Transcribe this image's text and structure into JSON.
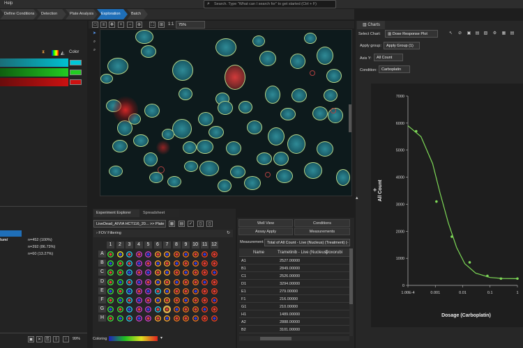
{
  "menu": {
    "help": "Help"
  },
  "search": {
    "placeholder": "Search. Type \"What can I search for\" to get started (Ctrl + F)"
  },
  "workflow": [
    "Define Conditions",
    "Detection",
    "Plate Analysis",
    "Exploration",
    "Batch"
  ],
  "left_panel": {
    "color_label": "Color",
    "stats": [
      {
        "label": "lum/",
        "n": "n=452",
        "pct": "(100%)"
      },
      {
        "label": "",
        "n": "n=392",
        "pct": "(86.73%)"
      },
      {
        "label": "",
        "n": "n=60",
        "pct": "(13.27%)"
      }
    ],
    "zoom_pct": "99%",
    "legend_colors": [
      "#00c8d8",
      "#22cc22",
      "#cc1111"
    ]
  },
  "image_toolbar": {
    "zoom_ratio": "1:1",
    "zoom_select": "75%"
  },
  "explorer": {
    "tabs": [
      "Experiment Explorer",
      "Spreadsheet"
    ],
    "dataset": "LiveDead_AIVIA HCT116_20...",
    "plate_link": ">> Plate",
    "fov_filter": "FOV Filtering",
    "coloring_label": "Coloring",
    "cols": [
      "1",
      "2",
      "3",
      "4",
      "5",
      "6",
      "7",
      "8",
      "9",
      "10",
      "11",
      "12"
    ],
    "rows": [
      "A",
      "B",
      "C",
      "D",
      "E",
      "F",
      "G",
      "H"
    ]
  },
  "table": {
    "buttons": [
      "Well View",
      "Conditions",
      "Assay Apply",
      "Measurements"
    ],
    "measurement_label": "Measurement",
    "measurement_value": "Total of All Count - Live (Nucleus) (Treatment) (-",
    "headers": [
      "Name",
      "Trametinib - Live (Nucleus)",
      "Doxorubi"
    ],
    "rows": [
      [
        "A1",
        "2527.00000"
      ],
      [
        "B1",
        "2849.00000"
      ],
      [
        "C1",
        "2526.00000"
      ],
      [
        "D1",
        "3294.00000"
      ],
      [
        "E1",
        "279.00000"
      ],
      [
        "F1",
        "216.00000"
      ],
      [
        "G1",
        "210.00000"
      ],
      [
        "H1",
        "1489.00000"
      ],
      [
        "A2",
        "2888.00000"
      ],
      [
        "B2",
        "3101.00000"
      ]
    ]
  },
  "charts": {
    "tab": "Charts",
    "select_chart_label": "Select Chart:",
    "select_chart_value": "Dose Response Plot",
    "apply_group_label": "Apply group:",
    "apply_group_value": "Apply Group (1)",
    "axis_y_label": "Axis Y:",
    "axis_y_value": "All Count",
    "condition_label": "Condition:",
    "condition_value": "Carboplatin"
  },
  "chart_data": {
    "type": "scatter",
    "title": "",
    "xlabel": "Dosage (Carboplatin)",
    "ylabel": "All Count",
    "x_scale": "log",
    "xlim": [
      0.0001,
      1
    ],
    "ylim": [
      0,
      7000
    ],
    "x_ticks": [
      "1.00E-4",
      "0.001",
      "0.01",
      "0.1",
      "1"
    ],
    "y_ticks": [
      "0",
      "1000",
      "2000",
      "3000",
      "4000",
      "5000",
      "6000",
      "7000"
    ],
    "series": [
      {
        "points": [
          [
            0.0002,
            5700
          ],
          [
            0.0011,
            3100
          ],
          [
            0.004,
            1800
          ],
          [
            0.018,
            850
          ],
          [
            0.08,
            350
          ],
          [
            0.25,
            250
          ],
          [
            1.0,
            250
          ]
        ],
        "color": "#7ed957"
      }
    ],
    "fit_curve": {
      "points": [
        [
          0.0001,
          5900
        ],
        [
          0.0003,
          5500
        ],
        [
          0.0008,
          4500
        ],
        [
          0.0015,
          3400
        ],
        [
          0.003,
          2300
        ],
        [
          0.006,
          1400
        ],
        [
          0.012,
          800
        ],
        [
          0.03,
          450
        ],
        [
          0.1,
          290
        ],
        [
          0.3,
          255
        ],
        [
          1.0,
          248
        ]
      ],
      "color": "#7ed957"
    }
  }
}
